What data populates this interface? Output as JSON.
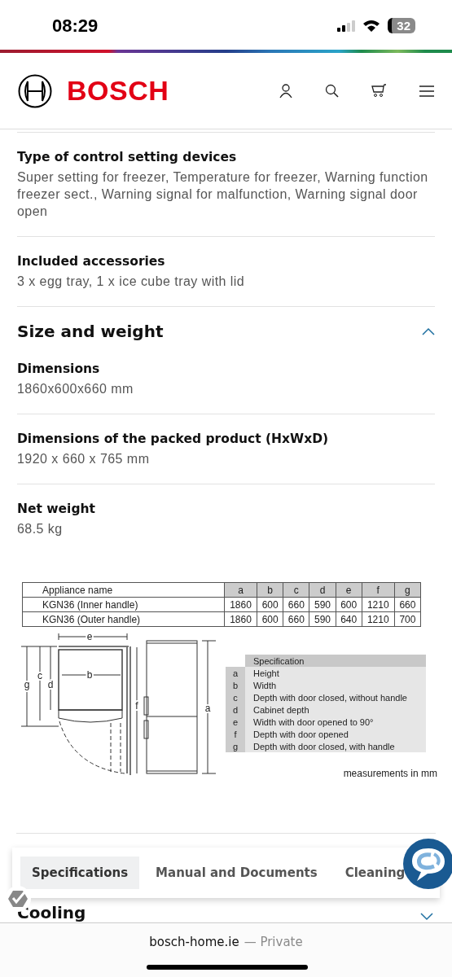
{
  "status_bar": {
    "time": "08:29",
    "battery": "32"
  },
  "header": {
    "brand": "BOSCH"
  },
  "specs_top": [
    {
      "label": "Type of control setting devices",
      "value": "Super setting for freezer, Temperature for freezer, Warning function freezer sect., Warning signal for malfunction, Warning signal door open"
    },
    {
      "label": "Included accessories",
      "value": "3 x egg tray, 1 x ice cube tray with lid"
    }
  ],
  "size_and_weight": {
    "title": "Size and weight",
    "expanded": true,
    "items": [
      {
        "label": "Dimensions",
        "value": "1860x600x660 mm"
      },
      {
        "label": "Dimensions of the packed product (HxWxD)",
        "value": "1920 x 660 x 765 mm"
      },
      {
        "label": "Net weight",
        "value": "68.5 kg"
      }
    ]
  },
  "dimension_sheet": {
    "table": {
      "columns": [
        "Appliance name",
        "a",
        "b",
        "c",
        "d",
        "e",
        "f",
        "g"
      ],
      "rows": [
        [
          "KGN36 (Inner handle)",
          "1860",
          "600",
          "660",
          "590",
          "600",
          "1210",
          "660"
        ],
        [
          "KGN36 (Outer handle)",
          "1860",
          "600",
          "660",
          "590",
          "640",
          "1210",
          "700"
        ]
      ]
    },
    "drawing_labels": [
      "e",
      "b",
      "c",
      "d",
      "g",
      "f",
      "a"
    ],
    "legend": {
      "title": "Specification",
      "rows": [
        {
          "letter": "a",
          "text": "Height"
        },
        {
          "letter": "b",
          "text": "Width"
        },
        {
          "letter": "c",
          "text": "Depth with door closed, without handle"
        },
        {
          "letter": "d",
          "text": "Cabinet depth"
        },
        {
          "letter": "e",
          "text": "Width with door opened to 90°"
        },
        {
          "letter": "f",
          "text": "Depth with door opened"
        },
        {
          "letter": "g",
          "text": "Depth with door closed, with handle"
        }
      ]
    },
    "note": "measurements in mm"
  },
  "tabs": [
    {
      "label": "Specifications",
      "selected": true
    },
    {
      "label": "Manual and Documents",
      "selected": false
    },
    {
      "label": "Cleaning",
      "selected": false
    }
  ],
  "next_section": {
    "title": "Cooling",
    "expanded": false
  },
  "browser_bar": {
    "domain": "bosch-home.ie",
    "mode": "— Private"
  }
}
